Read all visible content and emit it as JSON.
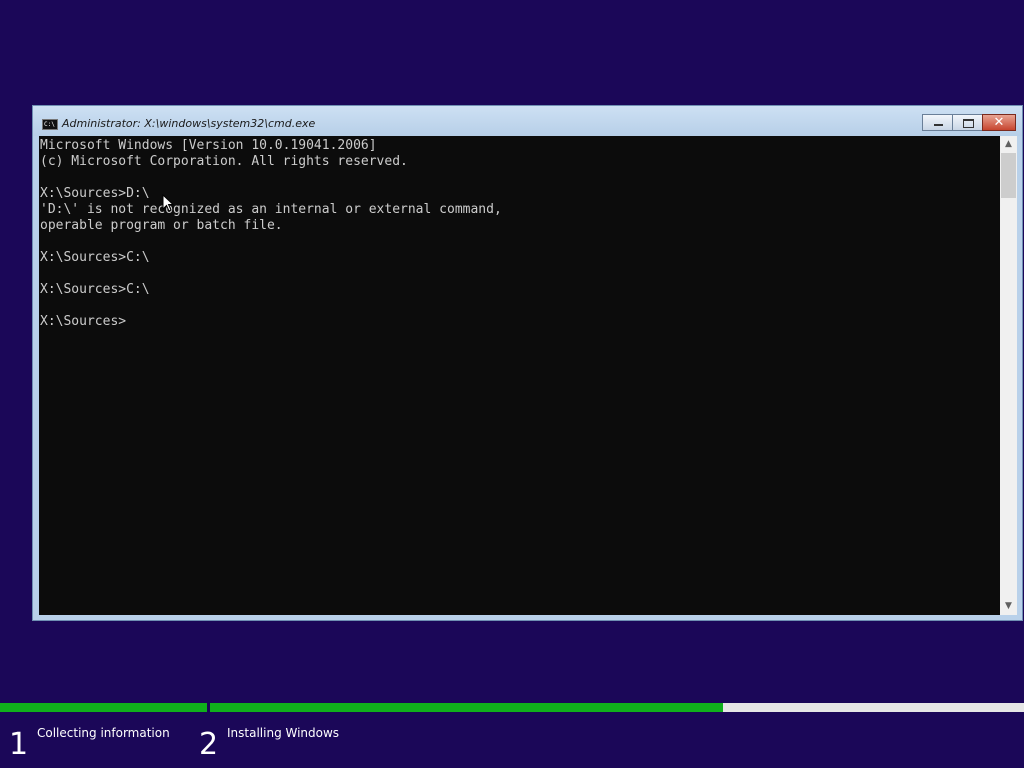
{
  "window": {
    "title": "Administrator: X:\\windows\\system32\\cmd.exe",
    "icon": "console-icon",
    "icon_text": "C:\\",
    "close_glyph": "✕"
  },
  "console": {
    "lines": [
      "Microsoft Windows [Version 10.0.19041.2006]",
      "(c) Microsoft Corporation. All rights reserved.",
      "",
      "X:\\Sources>D:\\",
      "'D:\\' is not recognized as an internal or external command,",
      "operable program or batch file.",
      "",
      "X:\\Sources>C:\\",
      "",
      "X:\\Sources>C:\\",
      "",
      "X:\\Sources>"
    ],
    "text_color": "#cccccc",
    "background": "#0c0c0c"
  },
  "setup": {
    "steps": [
      {
        "number": "1",
        "label": "Collecting information",
        "progress": 1.0
      },
      {
        "number": "2",
        "label": "Installing Windows",
        "progress": 0.63
      }
    ],
    "progress_color": "#10b01c",
    "background": "#1b0758"
  }
}
